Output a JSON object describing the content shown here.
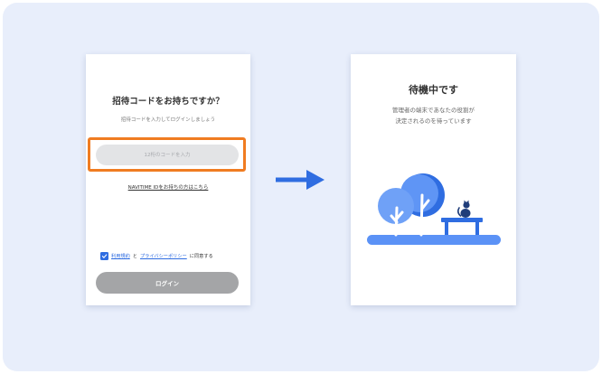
{
  "colors": {
    "background": "#e8eefb",
    "highlight": "#f07c21",
    "accent": "#2f6de1",
    "button_disabled": "#a4a5a7"
  },
  "invite_screen": {
    "title": "招待コードをお持ちですか？",
    "subtitle": "招待コードを入力してログインしましょう",
    "code_placeholder": "12桁のコードを入力",
    "navitime_link": "NAVITIME IDをお持ちの方はこちら",
    "terms_link": "利用規約",
    "conjunction": "と",
    "privacy_link": "プライバシーポリシー",
    "agree_suffix": "に同意する",
    "agree_checked": true,
    "login_label": "ログイン"
  },
  "waiting_screen": {
    "title": "待機中です",
    "message_line1": "管理者の端末であなたの役割が",
    "message_line2": "決定されるのを待っています"
  },
  "icons": {
    "arrow": "right-arrow-icon",
    "checkbox": "check-icon",
    "illustration": "park-bench-cat-illustration"
  }
}
